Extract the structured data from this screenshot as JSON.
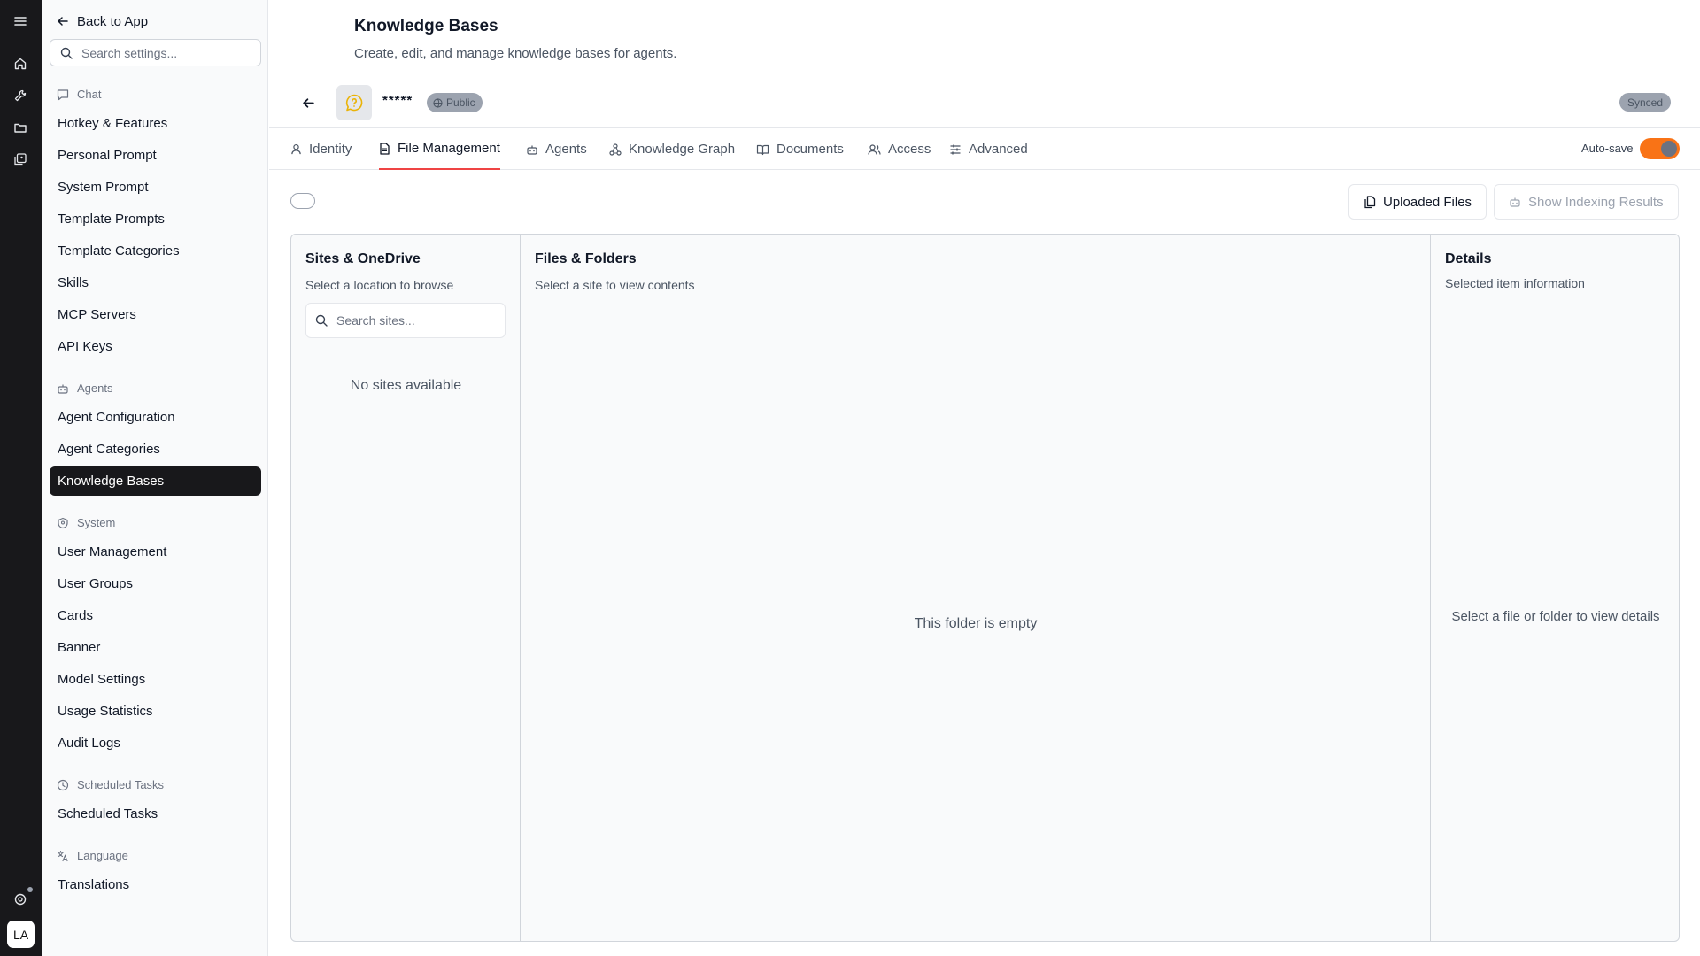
{
  "rail": {
    "avatar_initials": "LA"
  },
  "sidebar": {
    "back_label": "Back to App",
    "search_placeholder": "Search settings...",
    "groups": [
      {
        "label": "Chat",
        "icon": "chat-icon",
        "items": [
          "Hotkey & Features",
          "Personal Prompt",
          "System Prompt",
          "Template Prompts",
          "Template Categories",
          "Skills",
          "MCP Servers",
          "API Keys"
        ]
      },
      {
        "label": "Agents",
        "icon": "bot-icon",
        "items": [
          "Agent Configuration",
          "Agent Categories",
          "Knowledge Bases"
        ]
      },
      {
        "label": "System",
        "icon": "shield-icon",
        "items": [
          "User Management",
          "User Groups",
          "Cards",
          "Banner",
          "Model Settings",
          "Usage Statistics",
          "Audit Logs"
        ]
      },
      {
        "label": "Scheduled Tasks",
        "icon": "clock-icon",
        "items": [
          "Scheduled Tasks"
        ]
      },
      {
        "label": "Language",
        "icon": "translate-icon",
        "items": [
          "Translations"
        ]
      }
    ],
    "active_item": "Knowledge Bases"
  },
  "header": {
    "title": "Knowledge Bases",
    "subtitle": "Create, edit, and manage knowledge bases for agents.",
    "kb_name": "*****",
    "visibility_badge": "Public",
    "sync_badge": "Synced"
  },
  "tabs": [
    {
      "label": "Identity",
      "icon": "user-icon",
      "active": false
    },
    {
      "label": "File Management",
      "icon": "file-icon",
      "active": true
    },
    {
      "label": "Agents",
      "icon": "bot-icon",
      "active": false
    },
    {
      "label": "Knowledge Graph",
      "icon": "graph-icon",
      "active": false
    },
    {
      "label": "Documents",
      "icon": "book-icon",
      "active": false
    },
    {
      "label": "Access",
      "icon": "users-icon",
      "active": false
    },
    {
      "label": "Advanced",
      "icon": "sliders-icon",
      "active": false
    }
  ],
  "autosave": {
    "label": "Auto-save",
    "enabled": true
  },
  "toolbar": {
    "uploaded_files_label": "Uploaded Files",
    "show_indexing_label": "Show Indexing Results"
  },
  "panels": {
    "sites": {
      "title": "Sites & OneDrive",
      "subtitle": "Select a location to browse",
      "search_placeholder": "Search sites...",
      "empty": "No sites available"
    },
    "files": {
      "title": "Files & Folders",
      "subtitle": "Select a site to view contents",
      "empty": "This folder is empty"
    },
    "details": {
      "title": "Details",
      "subtitle": "Selected item information",
      "empty": "Select a file or folder to view details"
    }
  },
  "colors": {
    "accent": "#ef4444",
    "toggle_on": "#f97316",
    "rail_bg": "#18181b",
    "active_item_bg": "#18181b"
  }
}
